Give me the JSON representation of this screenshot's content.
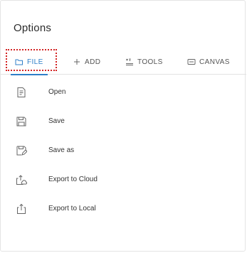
{
  "panel": {
    "title": "Options"
  },
  "tabs": [
    {
      "label": "FILE",
      "icon": "folder-icon",
      "active": true
    },
    {
      "label": "ADD",
      "icon": "plus-icon",
      "active": false
    },
    {
      "label": "TOOLS",
      "icon": "tools-icon",
      "active": false
    },
    {
      "label": "CANVAS",
      "icon": "canvas-icon",
      "active": false
    }
  ],
  "menu": {
    "items": [
      {
        "label": "Open",
        "icon": "open-file-icon"
      },
      {
        "label": "Save",
        "icon": "save-icon"
      },
      {
        "label": "Save as",
        "icon": "save-as-icon"
      },
      {
        "label": "Export to Cloud",
        "icon": "export-cloud-icon"
      },
      {
        "label": "Export to Local",
        "icon": "export-local-icon"
      }
    ]
  },
  "colors": {
    "accent": "#2f7fc8",
    "focus_outline": "#d32323",
    "text": "#333333"
  }
}
